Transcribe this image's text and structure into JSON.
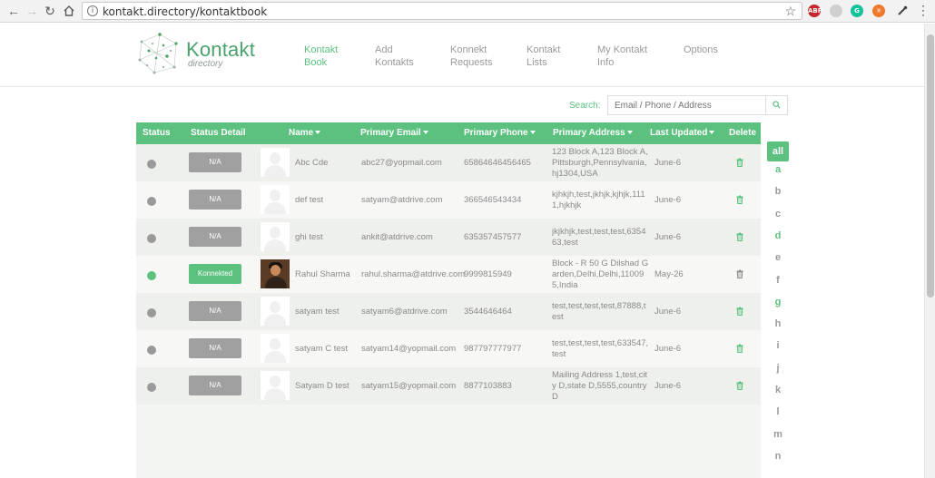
{
  "browser": {
    "url": "kontakt.directory/kontaktbook",
    "extensions": [
      {
        "name": "abp-extension",
        "text": "ABP",
        "color": "#c8262e"
      },
      {
        "name": "eyedropper-extension",
        "text": "",
        "color": "#cfcfcf"
      },
      {
        "name": "grammarly-extension",
        "text": "G",
        "color": "#15c39a"
      },
      {
        "name": "x-extension",
        "text": "✕",
        "color": "#f0792e"
      }
    ]
  },
  "header": {
    "logo_title": "Kontakt",
    "logo_subtitle": "directory",
    "nav": [
      {
        "line1": "Kontakt",
        "line2": "Book",
        "active": true
      },
      {
        "line1": "Add",
        "line2": "Kontakts",
        "active": false
      },
      {
        "line1": "Konnekt",
        "line2": "Requests",
        "active": false
      },
      {
        "line1": "Kontakt",
        "line2": "Lists",
        "active": false
      },
      {
        "line1": "My Kontakt",
        "line2": "Info",
        "active": false
      },
      {
        "line1": "Options",
        "line2": "",
        "active": false
      }
    ]
  },
  "search": {
    "label": "Search:",
    "placeholder": "Email / Phone / Address"
  },
  "table": {
    "headers": {
      "status": "Status",
      "status_detail": "Status Detail",
      "name": "Name",
      "email": "Primary Email",
      "phone": "Primary Phone",
      "address": "Primary Address",
      "updated": "Last Updated",
      "delete": "Delete"
    },
    "rows": [
      {
        "connected": false,
        "badge": "N/A",
        "photo": false,
        "name": "Abc Cde",
        "email": "abc27@yopmail.com",
        "phone": "65864646456465",
        "address": "123 Block A,123 Block A,Pittsburgh,Pennsylvania,hj1304,USA",
        "updated": "June-6"
      },
      {
        "connected": false,
        "badge": "N/A",
        "photo": false,
        "name": "def test",
        "email": "satyam@atdrive.com",
        "phone": "366546543434",
        "address": "kjhkjh,test,jkhjk,kjhjk,1111,hjkhjk",
        "updated": "June-6"
      },
      {
        "connected": false,
        "badge": "N/A",
        "photo": false,
        "name": "ghi test",
        "email": "ankit@atdrive.com",
        "phone": "635357457577",
        "address": "jkjkhjk,test,test,test,635463,test",
        "updated": "June-6"
      },
      {
        "connected": true,
        "badge": "Konnekted",
        "photo": true,
        "name": "Rahul Sharma",
        "email": "rahul.sharma@atdrive.com",
        "phone": "9999815949",
        "address": "Block - R 50 G Dilshad Garden,Delhi,Delhi,110095,India",
        "updated": "May-26"
      },
      {
        "connected": false,
        "badge": "N/A",
        "photo": false,
        "name": "satyam test",
        "email": "satyam6@atdrive.com",
        "phone": "3544646464",
        "address": "test,test,test,test,87888,test",
        "updated": "June-6"
      },
      {
        "connected": false,
        "badge": "N/A",
        "photo": false,
        "name": "satyam C test",
        "email": "satyam14@yopmail.com",
        "phone": "987797777977",
        "address": "test,test,test,test,633547,test",
        "updated": "June-6"
      },
      {
        "connected": false,
        "badge": "N/A",
        "photo": false,
        "name": "Satyam D test",
        "email": "satyam15@yopmail.com",
        "phone": "8877103883",
        "address": "Mailing Address 1,test,city D,state D,5555,country D",
        "updated": "June-6"
      }
    ]
  },
  "alphabet": [
    {
      "label": "all",
      "has": true
    },
    {
      "label": "a",
      "has": true
    },
    {
      "label": "b",
      "has": false
    },
    {
      "label": "c",
      "has": false
    },
    {
      "label": "d",
      "has": true
    },
    {
      "label": "e",
      "has": false
    },
    {
      "label": "f",
      "has": false
    },
    {
      "label": "g",
      "has": true
    },
    {
      "label": "h",
      "has": false
    },
    {
      "label": "i",
      "has": false
    },
    {
      "label": "j",
      "has": false
    },
    {
      "label": "k",
      "has": false
    },
    {
      "label": "l",
      "has": false
    },
    {
      "label": "m",
      "has": false
    },
    {
      "label": "n",
      "has": false
    }
  ],
  "colors": {
    "accent": "#5cc17f",
    "inactive": "#a0a0a0"
  }
}
